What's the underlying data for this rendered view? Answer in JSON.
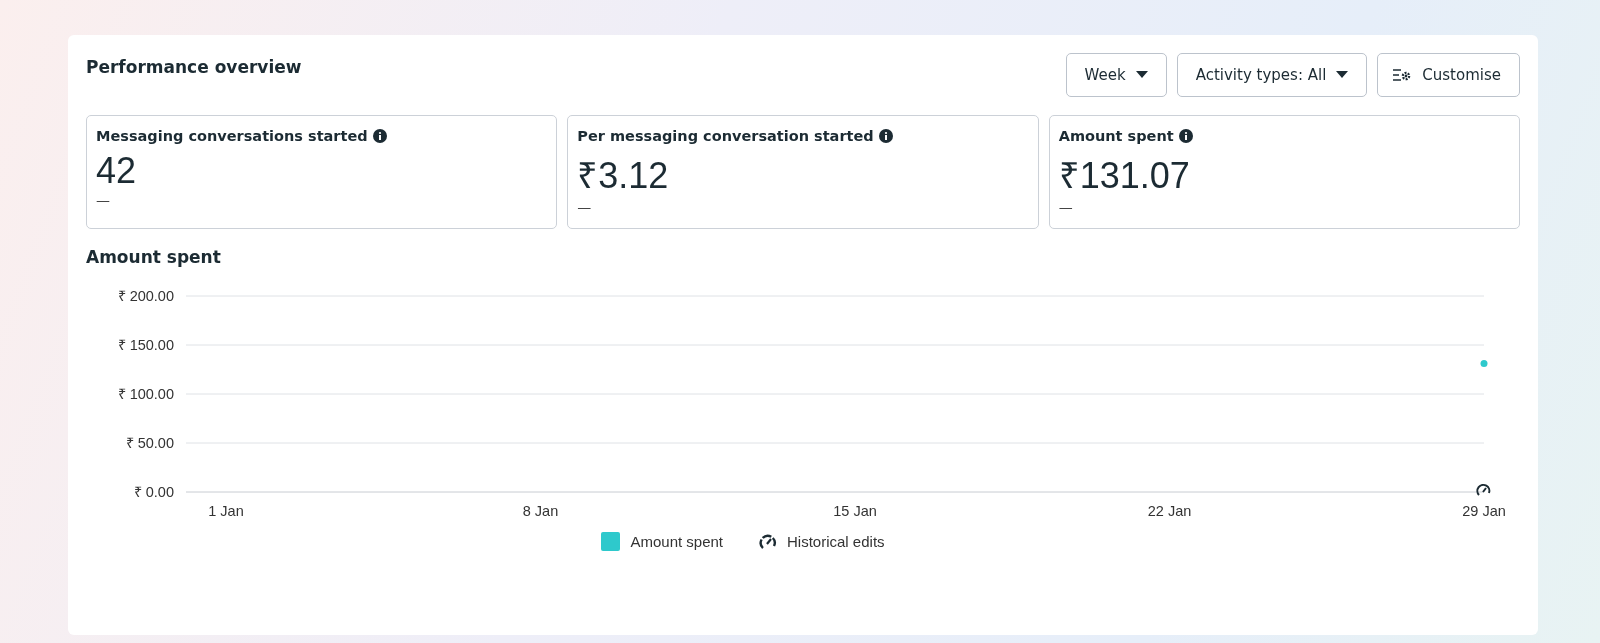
{
  "title": "Performance overview",
  "controls": [
    {
      "kind": "dropdown",
      "label": "Week"
    },
    {
      "kind": "dropdown",
      "label": "Activity types: All"
    },
    {
      "kind": "customise",
      "label": "Customise"
    }
  ],
  "metrics": [
    {
      "label": "Messaging conversations started",
      "value": "42",
      "change": "—"
    },
    {
      "label": "Per messaging conversation started",
      "value": "₹3.12",
      "change": "—"
    },
    {
      "label": "Amount spent",
      "value": "₹131.07",
      "change": "—"
    }
  ],
  "chart": {
    "title": "Amount spent",
    "chart_data": {
      "type": "line",
      "categories": [
        "1 Jan",
        "8 Jan",
        "15 Jan",
        "22 Jan",
        "29 Jan"
      ],
      "grid": true,
      "series": [
        {
          "name": "Amount spent",
          "color": "#2ec9cc",
          "marker": true,
          "values": [
            null,
            null,
            null,
            null,
            131
          ]
        }
      ],
      "ylim": [
        0,
        200
      ],
      "yticks": [
        {
          "value": 0,
          "label": "₹ 0.00"
        },
        {
          "value": 50,
          "label": "₹ 50.00"
        },
        {
          "value": 100,
          "label": "₹ 100.00"
        },
        {
          "value": 150,
          "label": "₹ 150.00"
        },
        {
          "value": 200,
          "label": "₹ 200.00"
        }
      ]
    },
    "legend": [
      {
        "kind": "edits",
        "label": "Historical edits"
      }
    ]
  }
}
